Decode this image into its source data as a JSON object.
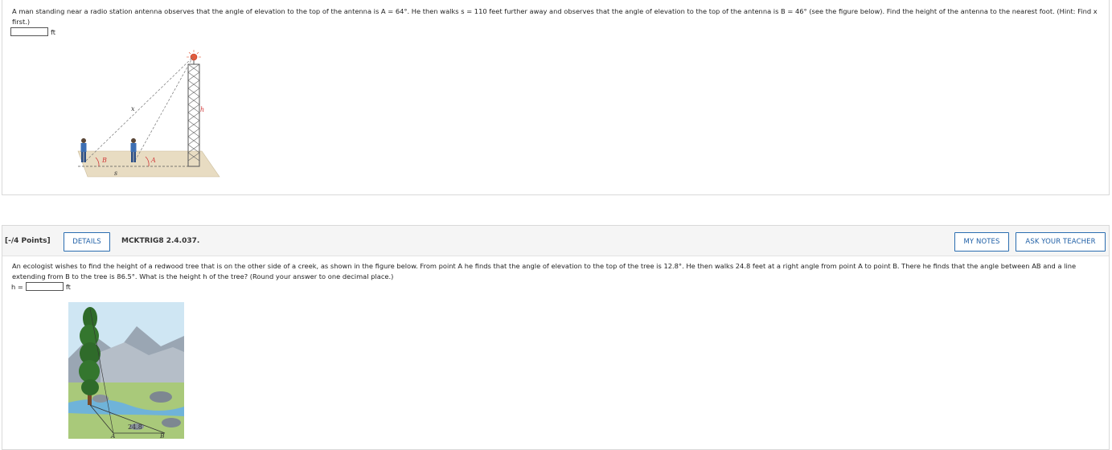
{
  "question1": {
    "text": "A man standing near a radio station antenna observes that the angle of elevation to the top of the antenna is A = 64°.  He then walks  s = 110  feet further away and observes that the angle of elevation to the top of the antenna is  B = 46°  (see the figure below). Find the height of the antenna to the nearest foot. (Hint: Find x first.)",
    "answer_value": "",
    "unit": "ft",
    "figure_labels": {
      "x": "x",
      "h": "h",
      "B": "B",
      "A": "A",
      "s": "s"
    }
  },
  "question2": {
    "points": "[-/4 Points]",
    "details_label": "DETAILS",
    "code": "MCKTRIG8 2.4.037.",
    "my_notes_label": "MY NOTES",
    "ask_teacher_label": "ASK YOUR TEACHER",
    "text": "An ecologist wishes to find the height of a redwood tree that is on the other side of a creek, as shown in the figure below. From point A he finds that the angle of elevation to the top of the tree is 12.8°. He then walks 24.8 feet at a right angle from point A to point B. There he finds that the angle between AB and a line extending from B to the tree is 86.5°. What is the height h of the tree? (Round your answer to one decimal place.)",
    "answer_label": "h =",
    "answer_value": "",
    "unit": "ft",
    "figure_labels": {
      "distance": "24.8",
      "A": "A",
      "B": "B"
    }
  },
  "colors": {
    "button_border": "#2a6db0",
    "button_text": "#1f5fa6",
    "header_bg": "#f5f5f5",
    "angle_label": "#d23a3a"
  }
}
